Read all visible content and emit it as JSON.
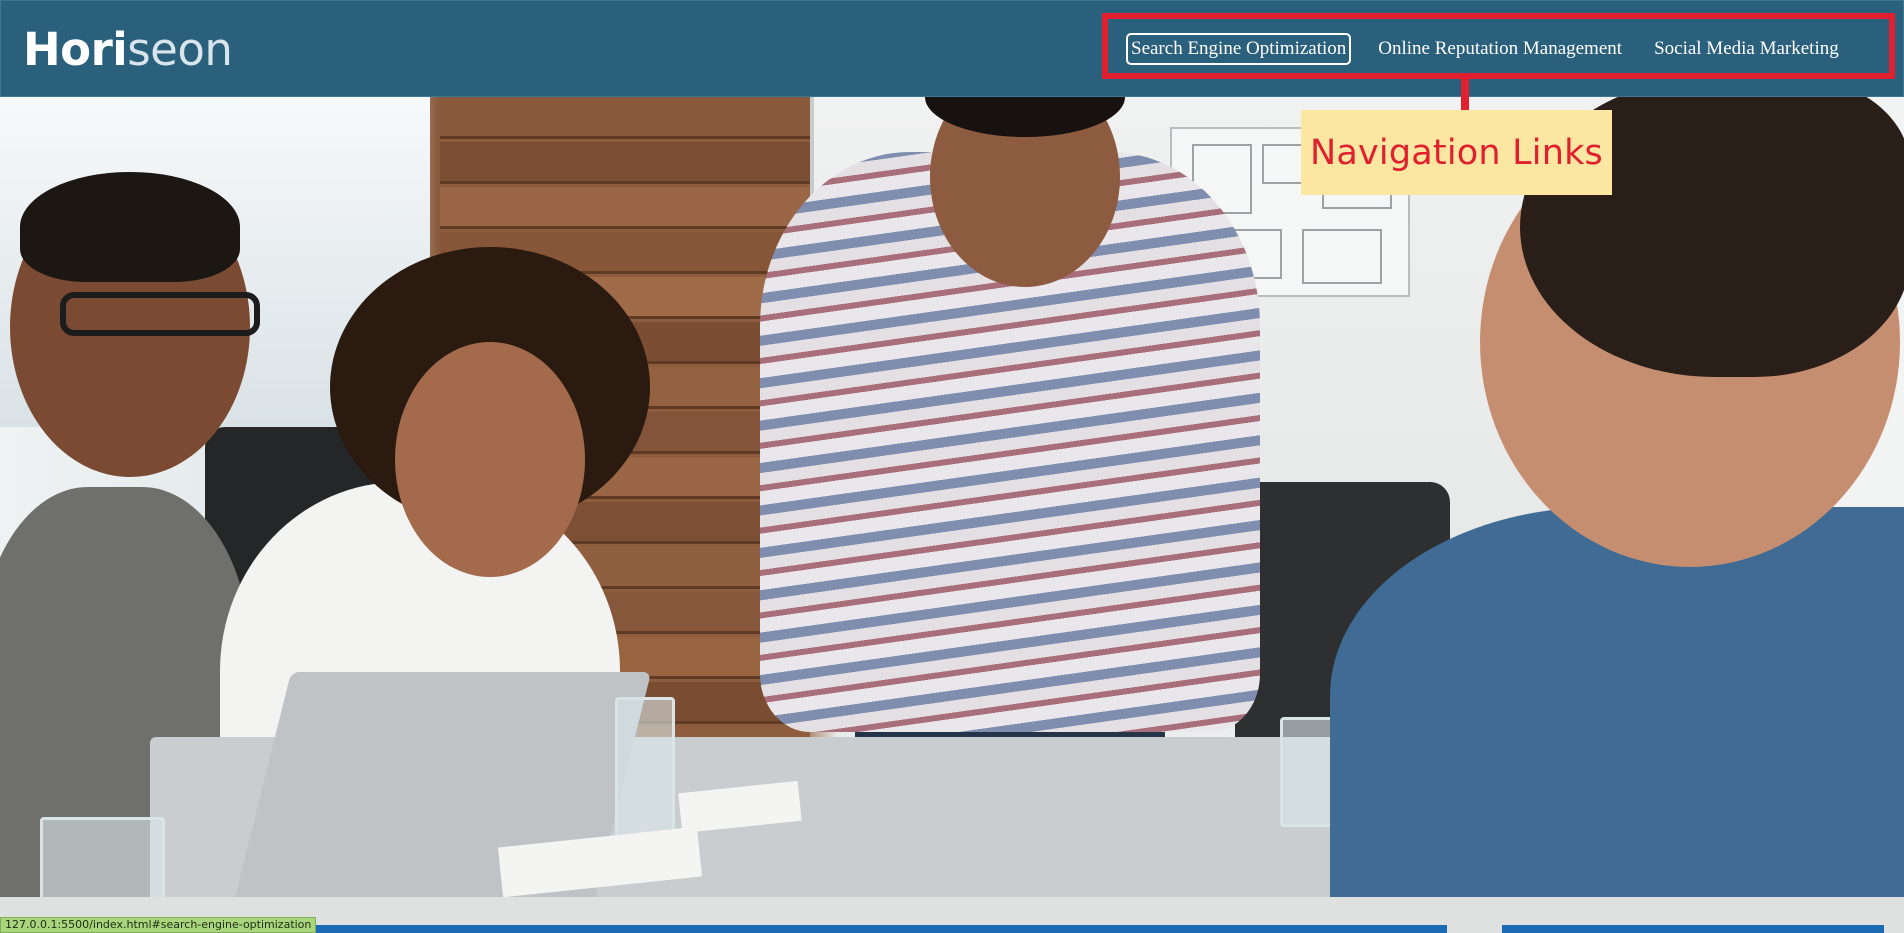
{
  "header": {
    "logo_main": "Hori",
    "logo_accent": "seon",
    "nav": [
      {
        "label": "Search Engine Optimization",
        "focused": true
      },
      {
        "label": "Online Reputation Management",
        "focused": false
      },
      {
        "label": "Social Media Marketing",
        "focused": false
      }
    ]
  },
  "annotation": {
    "callout_label": "Navigation Links",
    "highlight_color": "#e0202e",
    "callout_background": "#fbe7a1"
  },
  "colors": {
    "header_background": "#2a607c",
    "section_bar": "#1a6bb3"
  },
  "status_bar": {
    "url": "127.0.0.1:5500/index.html#search-engine-optimization"
  }
}
